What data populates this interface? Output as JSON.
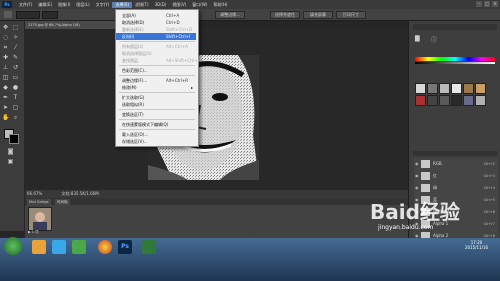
{
  "app": {
    "logo": "Ps"
  },
  "menubar": {
    "items": [
      "文件(F)",
      "编辑(E)",
      "图像(I)",
      "图层(L)",
      "文字(Y)",
      "选择(S)",
      "滤镜(T)",
      "3D(D)",
      "视图(V)",
      "窗口(W)",
      "帮助(H)"
    ],
    "active_index": 5
  },
  "window_buttons": [
    "–",
    "▢",
    "✕"
  ],
  "options_bar": {
    "buttons": [
      "调整边缘...",
      "选择并遮住",
      "填充屏幕",
      "打印尺寸"
    ]
  },
  "document_tab": {
    "title": "2170.jpg @ 66.7%(Alpha 1/8)"
  },
  "status_bar": {
    "zoom": "66.67%",
    "doc": "文档:835.5K/1.66M"
  },
  "mini_bridge": {
    "tabs": [
      "Mini Bridge",
      "时间轴"
    ],
    "thumb_label": "▶ 1 项"
  },
  "select_menu": {
    "items": [
      {
        "label": "全部(A)",
        "shortcut": "Ctrl+A",
        "state": "normal"
      },
      {
        "label": "取消选择(D)",
        "shortcut": "Ctrl+D",
        "state": "normal"
      },
      {
        "label": "重新选择(E)",
        "shortcut": "Shift+Ctrl+D",
        "state": "disabled"
      },
      {
        "label": "反向(I)",
        "shortcut": "Shift+Ctrl+I",
        "state": "highlighted"
      },
      {
        "type": "separator"
      },
      {
        "label": "所有图层(L)",
        "shortcut": "Alt+Ctrl+A",
        "state": "disabled"
      },
      {
        "label": "取消选择图层(S)",
        "shortcut": "",
        "state": "disabled"
      },
      {
        "label": "查找图层",
        "shortcut": "Alt+Shift+Ctrl+F",
        "state": "disabled"
      },
      {
        "type": "separator"
      },
      {
        "label": "色彩范围(C)...",
        "shortcut": "",
        "state": "normal"
      },
      {
        "type": "separator"
      },
      {
        "label": "调整边缘(F)...",
        "shortcut": "Alt+Ctrl+R",
        "state": "normal"
      },
      {
        "label": "修改(M)",
        "shortcut": "",
        "state": "normal",
        "submenu": true
      },
      {
        "type": "separator"
      },
      {
        "label": "扩大选取(G)",
        "shortcut": "",
        "state": "normal"
      },
      {
        "label": "选取相似(R)",
        "shortcut": "",
        "state": "normal"
      },
      {
        "type": "separator"
      },
      {
        "label": "变换选区(T)",
        "shortcut": "",
        "state": "normal"
      },
      {
        "type": "separator"
      },
      {
        "label": "在快速蒙版模式下编辑(Q)",
        "shortcut": "",
        "state": "normal"
      },
      {
        "type": "separator"
      },
      {
        "label": "载入选区(O)...",
        "shortcut": "",
        "state": "normal"
      },
      {
        "label": "存储选区(V)...",
        "shortcut": "",
        "state": "normal"
      }
    ]
  },
  "layers": [
    {
      "name": "RGB",
      "shortcut": "Ctrl+2",
      "selected": false
    },
    {
      "name": "红",
      "shortcut": "Ctrl+3",
      "selected": false
    },
    {
      "name": "绿",
      "shortcut": "Ctrl+4",
      "selected": false
    },
    {
      "name": "蓝",
      "shortcut": "Ctrl+5",
      "selected": false
    },
    {
      "name": "绿 副本",
      "shortcut": "Ctrl+6",
      "selected": false
    },
    {
      "name": "Alpha 1",
      "shortcut": "Ctrl+7",
      "selected": false
    },
    {
      "name": "Alpha 2",
      "shortcut": "Ctrl+8",
      "selected": false
    },
    {
      "name": "Alpha 3",
      "shortcut": "Ctrl+9",
      "selected": true
    }
  ],
  "watermark": {
    "text": "Baid经验",
    "url": "jingyan.baidu.com"
  },
  "clock": {
    "time": "17:20",
    "date": "2015/11/16"
  },
  "colors": {
    "menu_highlight": "#3875d7",
    "panel_bg": "#3e3e3e",
    "canvas_bg": "#282828"
  }
}
